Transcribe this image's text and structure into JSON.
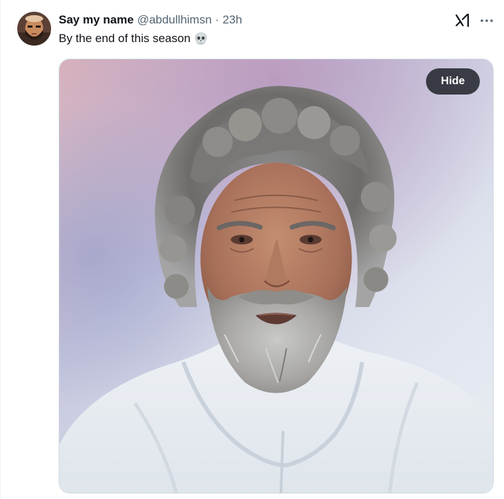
{
  "tweet": {
    "display_name": "Say my name",
    "handle": "@abdullhimsn",
    "separator": "·",
    "timestamp": "23h",
    "text": "By the end of this season",
    "emoji": "skull-emoji"
  },
  "media": {
    "hide_label": "Hide",
    "subject": "photo of gray-haired bearded man in white hoodie"
  },
  "icons": {
    "grok": "grok-icon",
    "more": "more-options-icon",
    "avatar": "user-avatar"
  },
  "colors": {
    "text_primary": "#0f1419",
    "text_secondary": "#536471",
    "border": "#cfd9de",
    "hide_button_bg": "#0f1419"
  }
}
